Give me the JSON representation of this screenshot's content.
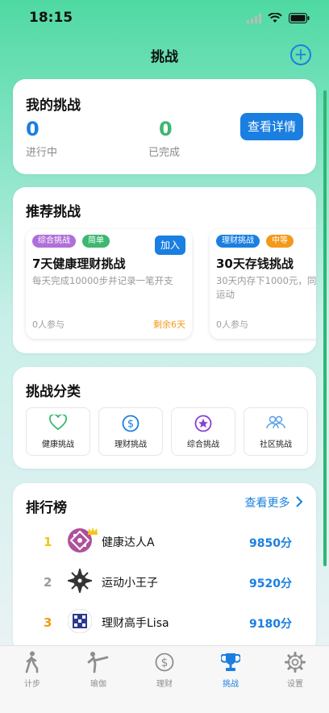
{
  "status": {
    "time": "18:15"
  },
  "nav": {
    "title": "挑战"
  },
  "my": {
    "title": "我的挑战",
    "ongoing_count": "0",
    "ongoing_label": "进行中",
    "done_count": "0",
    "done_label": "已完成",
    "detail_button": "查看详情"
  },
  "recommend": {
    "title": "推荐挑战",
    "cards": [
      {
        "tags": [
          "综合挑战",
          "简单"
        ],
        "title": "7天健康理财挑战",
        "desc": "每天完成10000步并记录一笔开支",
        "join": "加入",
        "participants": "0人参与",
        "remaining": "剩余6天"
      },
      {
        "tags": [
          "理财挑战",
          "中等"
        ],
        "title": "30天存钱挑战",
        "desc": "30天内存下1000元，同\n运动",
        "participants": "0人参与"
      }
    ]
  },
  "categories": {
    "title": "挑战分类",
    "items": [
      {
        "label": "健康挑战",
        "icon": "heart-icon",
        "color": "#3cb870"
      },
      {
        "label": "理财挑战",
        "icon": "dollar-icon",
        "color": "#1a7fe0"
      },
      {
        "label": "综合挑战",
        "icon": "star-icon",
        "color": "#8a3fd1"
      },
      {
        "label": "社区挑战",
        "icon": "people-icon",
        "color": "#5aa0e6"
      }
    ]
  },
  "leaderboard": {
    "title": "排行榜",
    "more": "查看更多",
    "rows": [
      {
        "rank": "1",
        "name": "健康达人A",
        "score": "9850分"
      },
      {
        "rank": "2",
        "name": "运动小王子",
        "score": "9520分"
      },
      {
        "rank": "3",
        "name": "理财高手Lisa",
        "score": "9180分"
      }
    ]
  },
  "tabs": [
    {
      "label": "计步",
      "icon": "walking-icon"
    },
    {
      "label": "瑜伽",
      "icon": "yoga-icon"
    },
    {
      "label": "理财",
      "icon": "dollar-icon"
    },
    {
      "label": "挑战",
      "icon": "trophy-icon",
      "active": true
    },
    {
      "label": "设置",
      "icon": "gear-icon"
    }
  ],
  "colors": {
    "accent": "#1a7fe0",
    "green": "#3cb870",
    "orange": "#f39a1a",
    "purple": "#b06fd8"
  }
}
